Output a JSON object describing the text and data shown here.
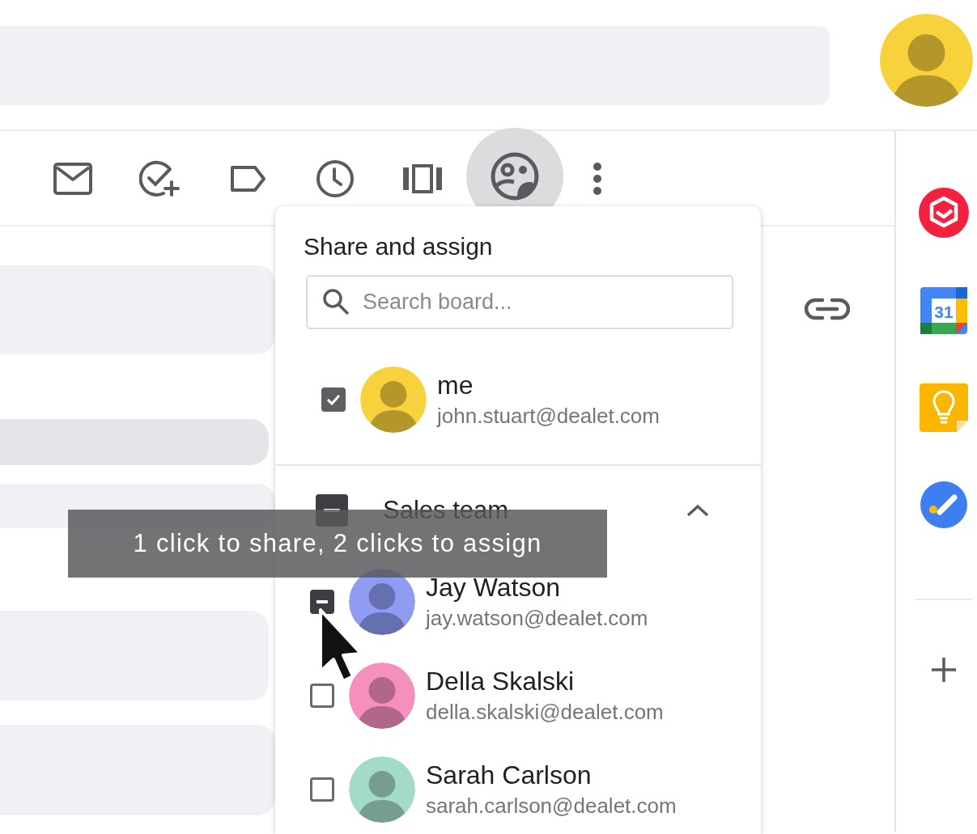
{
  "toolbar": {
    "buttons": [
      {
        "selected": false
      },
      {
        "selected": false
      },
      {
        "selected": false
      },
      {
        "selected": false
      },
      {
        "selected": false
      },
      {
        "selected": true
      },
      {
        "selected": false
      }
    ]
  },
  "side_panel": {
    "calendar_day": "31"
  },
  "share_popup": {
    "title": "Share and assign",
    "search": {
      "placeholder": "Search board..."
    },
    "me": {
      "name": "me",
      "email": "john.stuart@dealet.com",
      "checked": true,
      "color": "#f8d23c"
    },
    "group": {
      "name": "Sales team",
      "indeterminate": true,
      "expanded": true,
      "members": [
        {
          "name": "Jay Watson",
          "email": "jay.watson@dealet.com",
          "indeterminate": true,
          "color": "#8f9cf2"
        },
        {
          "name": "Della Skalski",
          "email": "della.skalski@dealet.com",
          "checked": false,
          "indeterminate": false,
          "color": "#f58fbc"
        },
        {
          "name": "Sarah Carlson",
          "email": "sarah.carlson@dealet.com",
          "checked": false,
          "indeterminate": false,
          "color": "#a3dcc6"
        }
      ]
    }
  },
  "tooltip": {
    "text": "1 click to share, 2 clicks to assign"
  }
}
